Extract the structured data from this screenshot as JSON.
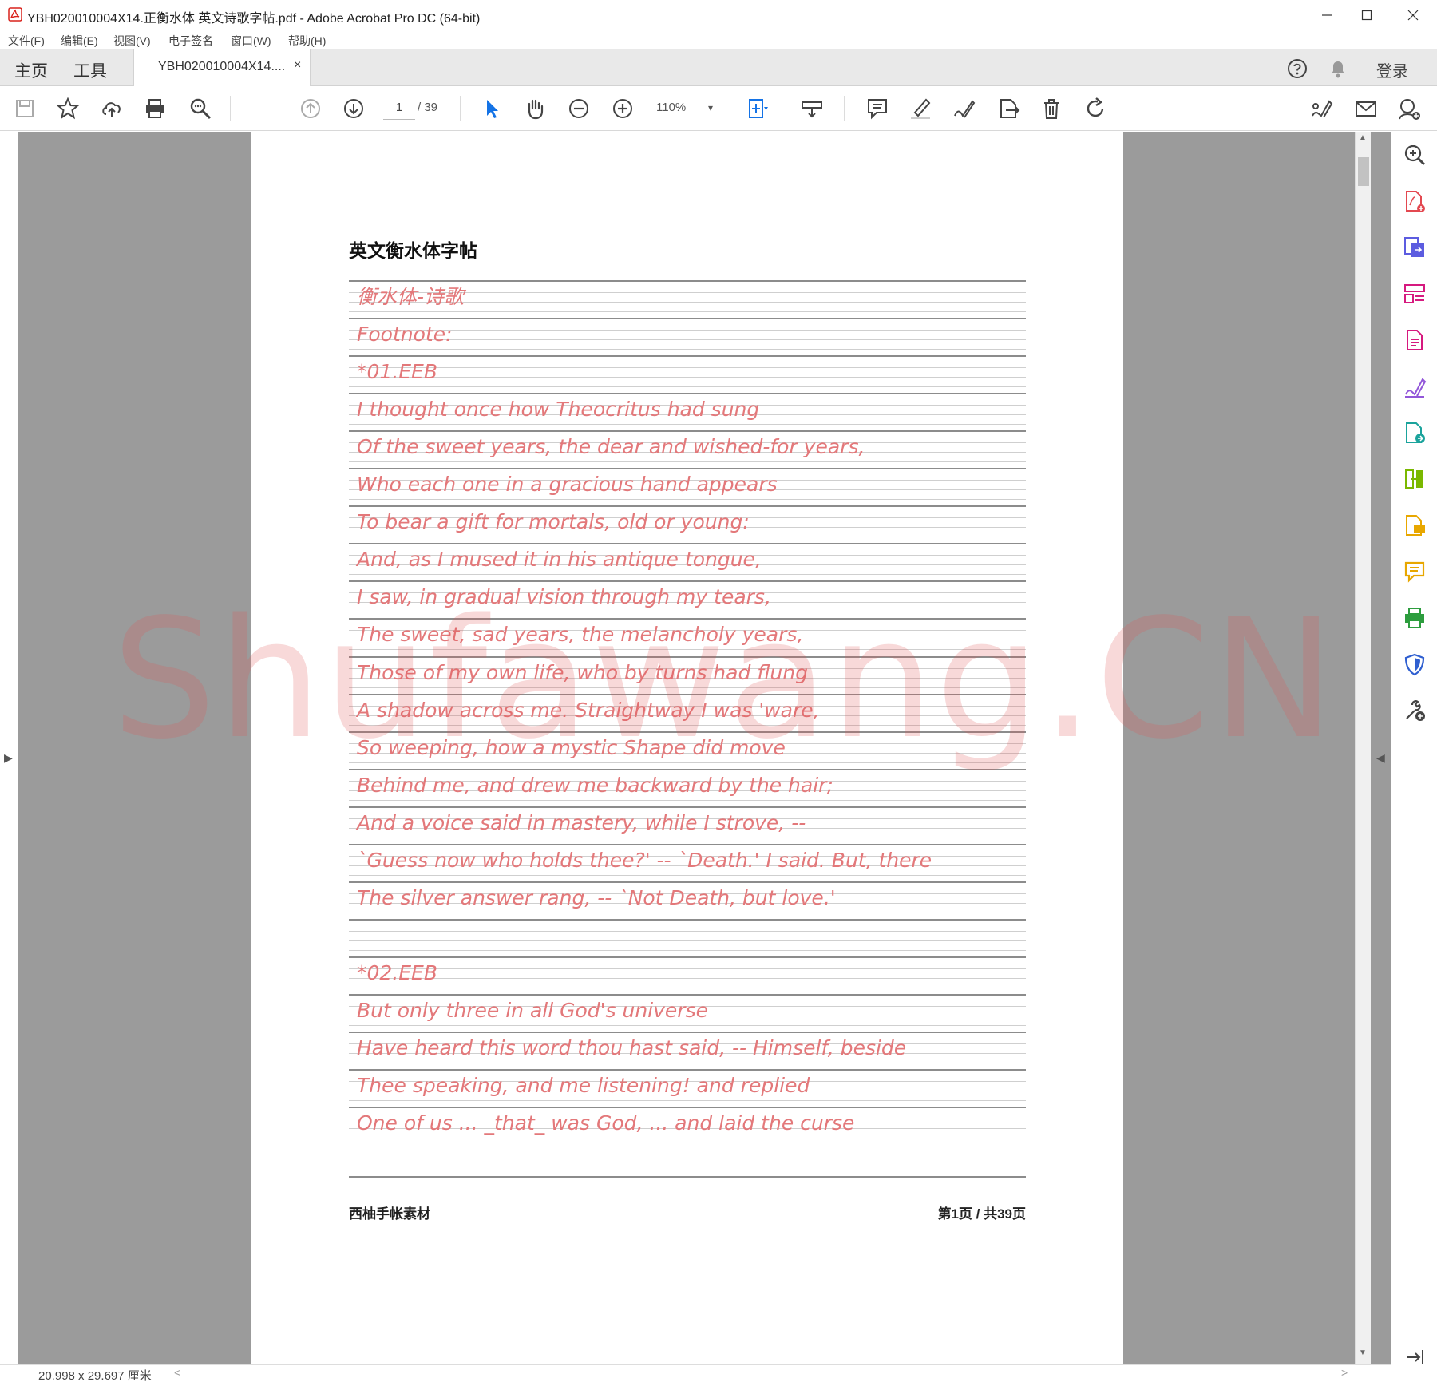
{
  "window": {
    "title": "YBH020010004X14.正衡水体 英文诗歌字帖.pdf - Adobe Acrobat Pro DC (64-bit)",
    "controls": [
      "minimize-icon",
      "maximize-icon",
      "close-icon"
    ]
  },
  "menu": [
    "文件(F)",
    "编辑(E)",
    "视图(V)",
    "电子签名",
    "窗口(W)",
    "帮助(H)"
  ],
  "tabs": {
    "home": "主页",
    "tools": "工具",
    "document": "YBH020010004X14....",
    "close": "×",
    "signin": "登录"
  },
  "toolbar": {
    "page_current": "1",
    "page_total": "/ 39",
    "zoom": "110%",
    "zoom_arrow": "▾",
    "icons": [
      "save-icon",
      "bookmark-star-icon",
      "cloud-upload-icon",
      "print-icon",
      "search-zoom-icon",
      "page-up-icon",
      "page-down-icon",
      "select-cursor-icon",
      "hand-icon",
      "zoom-out-icon",
      "zoom-in-icon",
      "fit-page-icon",
      "measure-ruler-icon",
      "comment-icon",
      "highlight-pen-icon",
      "sign-icon",
      "share-export-icon",
      "delete-icon",
      "rotate-icon",
      "fill-sign-icon",
      "email-icon",
      "account-icon"
    ]
  },
  "document": {
    "heading": "英文衡水体字帖",
    "lines": [
      "衡水体-诗歌",
      "Footnote:",
      "*01.EEB",
      "I thought once how Theocritus had sung",
      "Of the sweet years, the dear and wished-for years,",
      "Who each one in a gracious hand appears",
      "To bear a gift for mortals, old or young:",
      "And, as I mused it in his antique tongue,",
      "I saw, in gradual vision through my tears,",
      "The sweet, sad years, the melancholy years,",
      "Those of my own life, who by turns had flung",
      "A shadow across me. Straightway I was 'ware,",
      "So weeping, how a mystic Shape did move",
      "Behind me, and drew me backward by the hair;",
      "And a voice said in mastery, while I strove, --",
      "`Guess now who holds thee?' -- `Death.' I said. But, there",
      "The silver answer rang, -- `Not Death, but love.'",
      "",
      "*02.EEB",
      "But only three in all God's universe",
      "Have heard this word thou hast said, -- Himself, beside",
      "Thee speaking, and me listening! and replied",
      "One of us ... _that_ was God, ... and laid the curse"
    ],
    "footer_left": "西柚手帐素材",
    "footer_right": "第1页 / 共39页",
    "watermark": "Shufawang.CN",
    "ink_color": "#e3787a"
  },
  "status": {
    "page_size": "20.998 x 29.697 厘米",
    "scroll_left": "<",
    "scroll_right": ">"
  },
  "side_arrows": {
    "left": "▶",
    "right": "◀",
    "up": "▲",
    "down": "▼"
  },
  "right_rail_icons": [
    "enhance-zoom-icon",
    "create-pdf-icon",
    "export-pdf-icon",
    "organize-pages-icon",
    "edit-pdf-icon",
    "fill-sign-icon",
    "export-share-icon",
    "combine-files-icon",
    "request-signature-icon",
    "comment-tool-icon",
    "print-production-icon",
    "protect-shield-icon",
    "more-tools-icon",
    "collapse-panel-icon"
  ],
  "colors": {
    "accent_blue": "#1473e6",
    "acrobat_red": "#d9221c"
  }
}
